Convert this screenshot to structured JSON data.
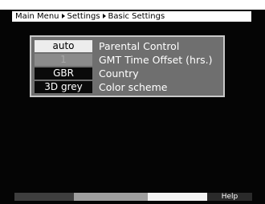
{
  "breadcrumb": {
    "items": [
      "Main Menu",
      "Settings",
      "Basic Settings"
    ]
  },
  "menu": {
    "rows": [
      {
        "value": "auto",
        "label": "Parental Control",
        "state": "selected"
      },
      {
        "value": "1",
        "label": "GMT Time Offset (hrs.)",
        "state": "disabled"
      },
      {
        "value": "GBR",
        "label": "Country",
        "state": "normal"
      },
      {
        "value": "3D grey",
        "label": "Color scheme",
        "state": "normal"
      }
    ]
  },
  "color_keys": {
    "red_label": "",
    "green_label": "",
    "yellow_label": "",
    "blue_label": "Help"
  }
}
